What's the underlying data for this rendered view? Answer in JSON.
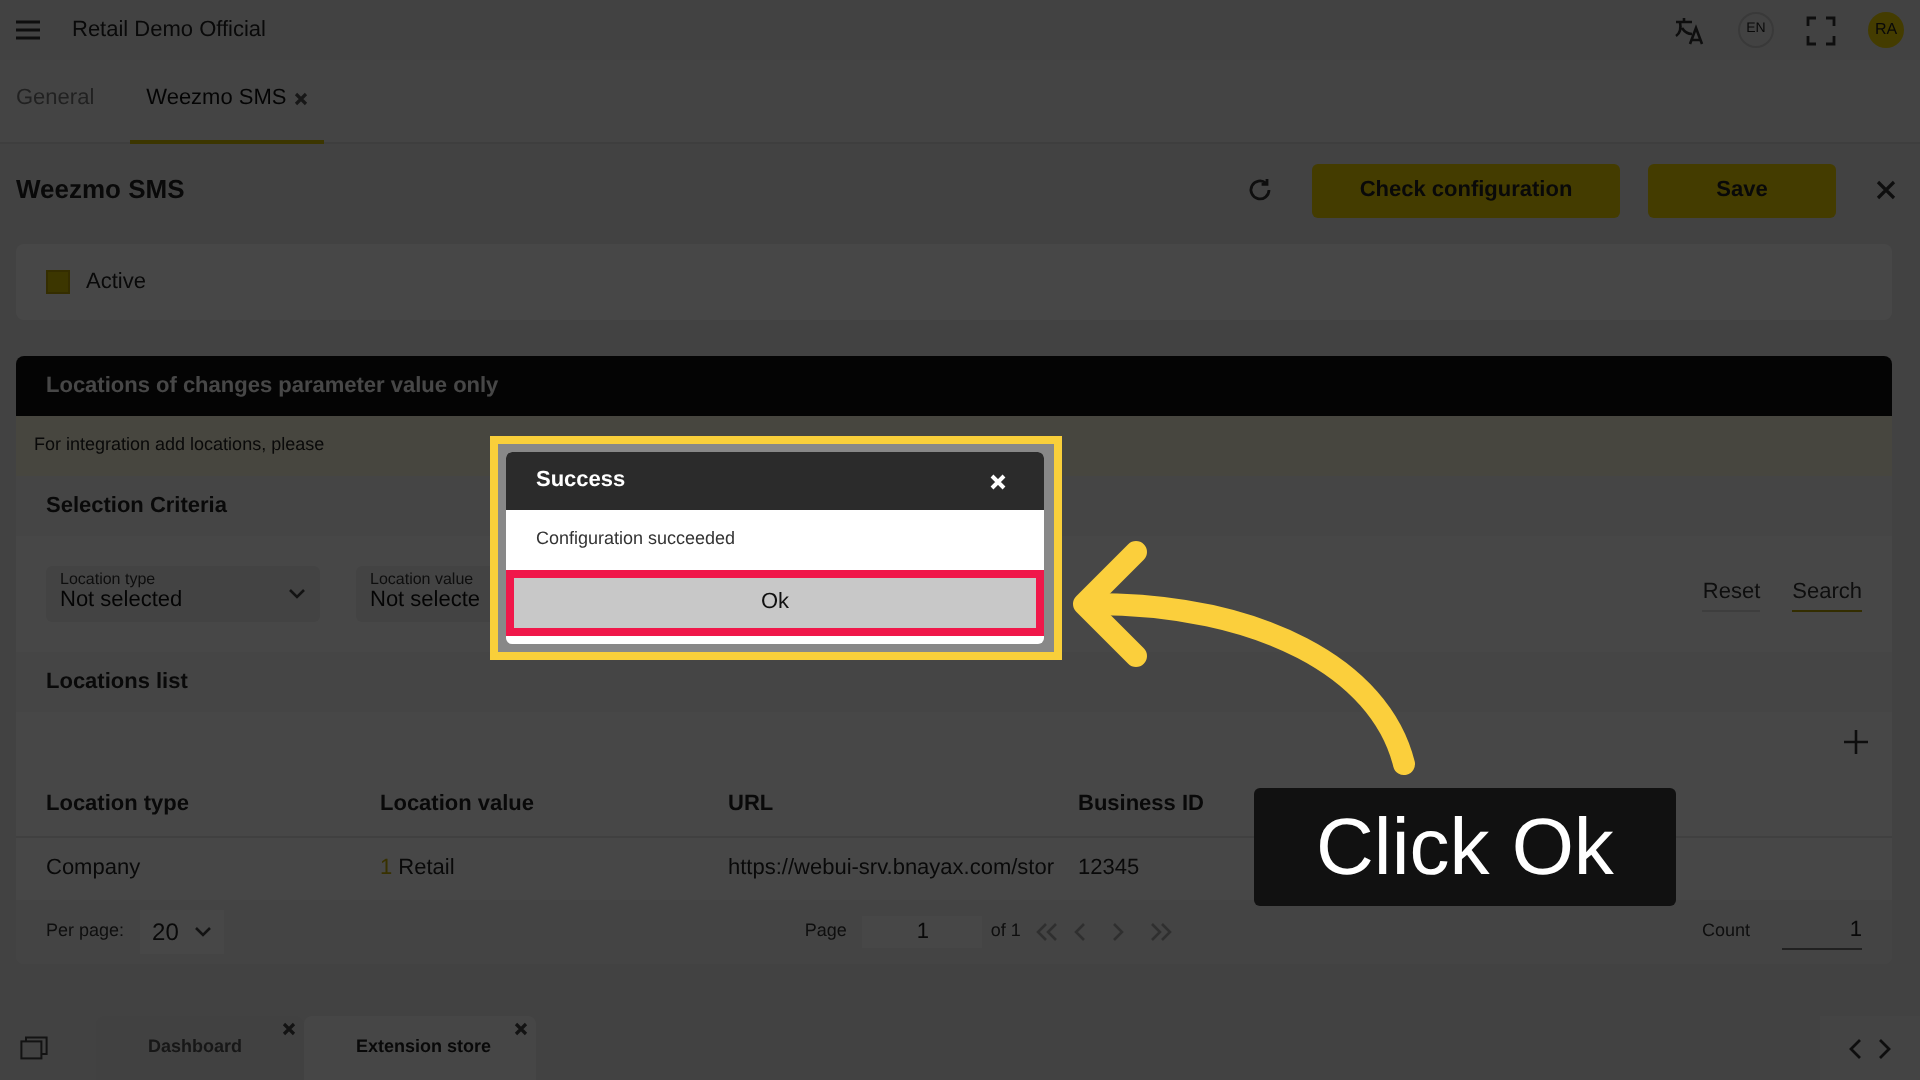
{
  "app_bar": {
    "title": "Retail Demo Official",
    "language": "EN",
    "avatar": "RA"
  },
  "tabs": [
    {
      "label": "General",
      "selected": false,
      "closable": false
    },
    {
      "label": "Weezmo SMS",
      "selected": true,
      "closable": true
    }
  ],
  "header": {
    "title": "Weezmo SMS",
    "buttons": [
      "Check configuration",
      "Save"
    ]
  },
  "active": {
    "label": "Active",
    "checked": true
  },
  "locations": {
    "title": "Locations of changes parameter value only",
    "notice": "For integration add locations, please",
    "criteria_title": "Selection Criteria",
    "filters": [
      {
        "label": "Location type",
        "value": "Not selected"
      },
      {
        "label": "Location value",
        "value": "Not selecte"
      }
    ],
    "actions": [
      {
        "label": "Reset",
        "selected": false
      },
      {
        "label": "Search",
        "selected": true
      }
    ],
    "list_title": "Locations list",
    "columns": [
      "Location type",
      "Location value",
      "URL",
      "Business ID"
    ],
    "rows": [
      {
        "location_type": "Company",
        "value_id": "1",
        "value_name": "Retail",
        "url": "https://webui-srv.bnayax.com/stor",
        "business_id": "12345"
      }
    ],
    "pagination": {
      "per_page_label": "Per page:",
      "per_page": "20",
      "page_label": "Page",
      "page": "1",
      "of": "of 1",
      "count_label": "Count",
      "count": "1"
    }
  },
  "bottom_tabs": [
    {
      "label": "Dashboard",
      "selected": false
    },
    {
      "label": "Extension store",
      "selected": true
    }
  ],
  "dialog": {
    "title": "Success",
    "message": "Configuration succeeded",
    "button": "Ok"
  },
  "callout": {
    "text": "Click Ok"
  }
}
